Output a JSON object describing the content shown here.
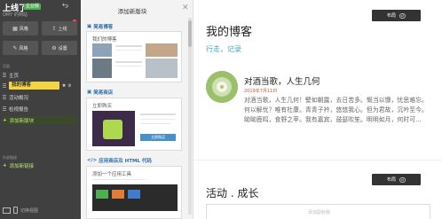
{
  "sidebar": {
    "brand": "上线了",
    "badge": "企业版",
    "owner": "OMY 的网站",
    "tools": {
      "theme_label": "风格",
      "publish_label": "上线",
      "layout_label": "风格",
      "settings_label": "设置"
    },
    "section_pages": "页面",
    "nav": [
      {
        "label": "主页"
      },
      {
        "label": "我的博客"
      },
      {
        "label": "活动概况"
      },
      {
        "label": "检视报告"
      },
      {
        "label": "添加新版块"
      }
    ],
    "section_links": "外部链接",
    "add_link": "添加新链接",
    "bottom_label": "切换视图"
  },
  "panel": {
    "title": "添加新版块",
    "categories": [
      {
        "label": "简易博客"
      },
      {
        "label": "简易商店"
      },
      {
        "label": "应用商店及 HTML 代码"
      }
    ],
    "cards": [
      {
        "title": "我们的博客"
      },
      {
        "title": "立即购买",
        "button": "立即购买"
      },
      {
        "title": "添加一个应用工具"
      }
    ]
  },
  "main": {
    "button_label": "布局",
    "blog_title": "我的博客",
    "blog_links": "行走，记录",
    "post": {
      "title": "对酒当歌，人生几何",
      "date": "2019年7月11日",
      "body": "对酒当歌，人生几何！譬如朝露，去日苦多。慨当以慷，忧思难忘。何以解忧？唯有杜康。青青子衿，悠悠我心。但为君故，沉吟至今。呦呦鹿鸣，食野之苹。我有嘉宾，鼓瑟吹笙。明明如月，何时可..."
    },
    "section2_title": "活动 . 成长",
    "add_block_placeholder": "添加副标题"
  },
  "colors": {
    "sidebar_bg": "#404040",
    "active_pill": "#f5d442",
    "link_blue": "#3aa8c1",
    "date_red": "#d64f3f",
    "category_blue": "#2f6ea8",
    "add_green": "#bde07c"
  }
}
